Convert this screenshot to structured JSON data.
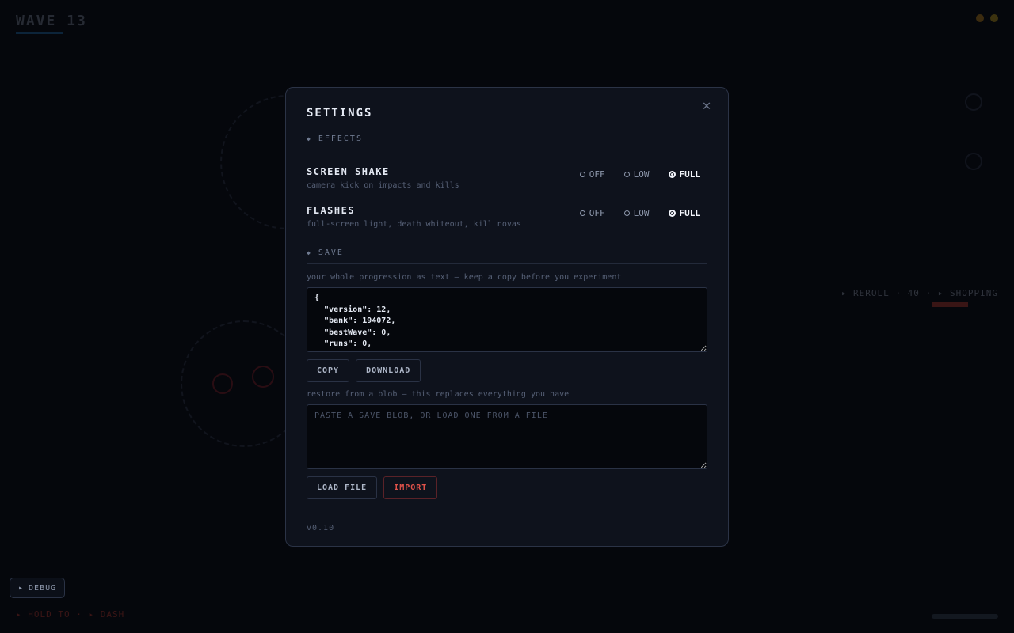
{
  "game": {
    "wave_title": "WAVE 13",
    "shop_text": "▸ REROLL  · 40  ·  ▸ SHOPPING",
    "bottom_left_text": "▸ HOLD TO · ▸ DASH",
    "debug_label": "DEBUG",
    "colors": {
      "accent": "#1f6fb0",
      "danger": "#c2392e"
    }
  },
  "modal": {
    "title": "SETTINGS",
    "close_icon": "close-icon",
    "effects": {
      "section_label": "EFFECTS",
      "screen_shake": {
        "name": "SCREEN SHAKE",
        "description": "camera kick on impacts and kills",
        "options": [
          "OFF",
          "LOW",
          "FULL"
        ],
        "selected": "FULL"
      },
      "flashes": {
        "name": "FLASHES",
        "description": "full-screen light, death whiteout, kill novas",
        "options": [
          "OFF",
          "LOW",
          "FULL"
        ],
        "selected": "FULL"
      }
    },
    "save": {
      "section_label": "SAVE",
      "export_hint": "your whole progression as text — keep a copy before you experiment",
      "blob": "{\n  \"version\": 12,\n  \"bank\": 194072,\n  \"bestWave\": 0,\n  \"runs\": 0,",
      "copy_label": "COPY",
      "download_label": "DOWNLOAD",
      "import_hint": "restore from a blob — this replaces everything you have",
      "import_placeholder": "PASTE A SAVE BLOB, OR LOAD ONE FROM A FILE",
      "import_value": "",
      "load_file_label": "LOAD FILE",
      "import_label": "IMPORT"
    },
    "version": "v0.10"
  }
}
